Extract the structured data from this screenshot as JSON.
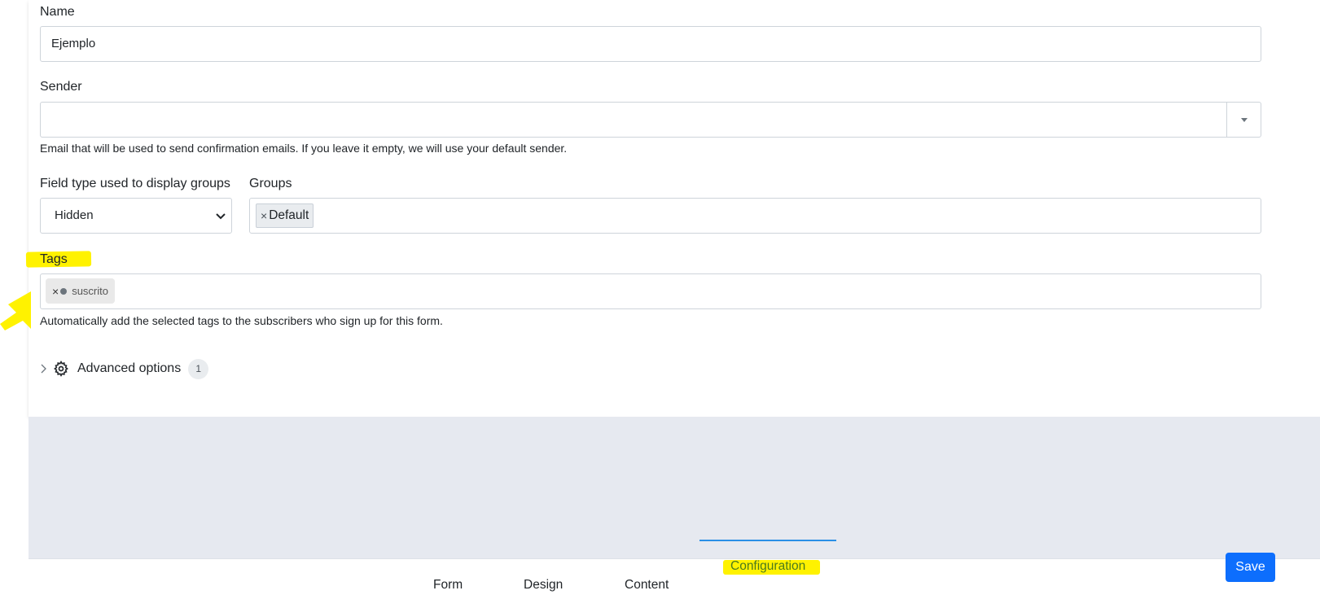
{
  "form": {
    "name_label": "Name",
    "name_value": "Ejemplo",
    "sender_label": "Sender",
    "sender_value": "",
    "sender_help": "Email that will be used to send confirmation emails. If you leave it empty, we will use your default sender.",
    "field_type_label": "Field type used to display groups",
    "field_type_value": "Hidden",
    "groups_label": "Groups",
    "groups": [
      {
        "remove_glyph": "×",
        "label": "Default"
      }
    ],
    "tags_label": "Tags",
    "tags": [
      {
        "remove_glyph": "×",
        "label": "suscrito",
        "dot_color": "#6c757d"
      }
    ],
    "tags_help": "Automatically add the selected tags to the subscribers who sign up for this form.",
    "advanced_label": "Advanced options",
    "advanced_count": "1"
  },
  "tabs": [
    {
      "label": "Form",
      "active": false
    },
    {
      "label": "Design",
      "active": false
    },
    {
      "label": "Content",
      "active": false
    },
    {
      "label": "Configuration",
      "active": true
    }
  ],
  "save_label": "Save",
  "colors": {
    "accent": "#0d6efd",
    "highlight": "#fff200",
    "background_gray": "#e6e9f0",
    "tab_underline": "#2a8fe6"
  },
  "icons": {
    "sender_dropdown": "caret-down-icon",
    "field_type_dropdown": "chevron-down-icon",
    "advanced_expand": "chevron-right-icon",
    "advanced": "gear-icon",
    "annotation": "yellow-arrow"
  }
}
